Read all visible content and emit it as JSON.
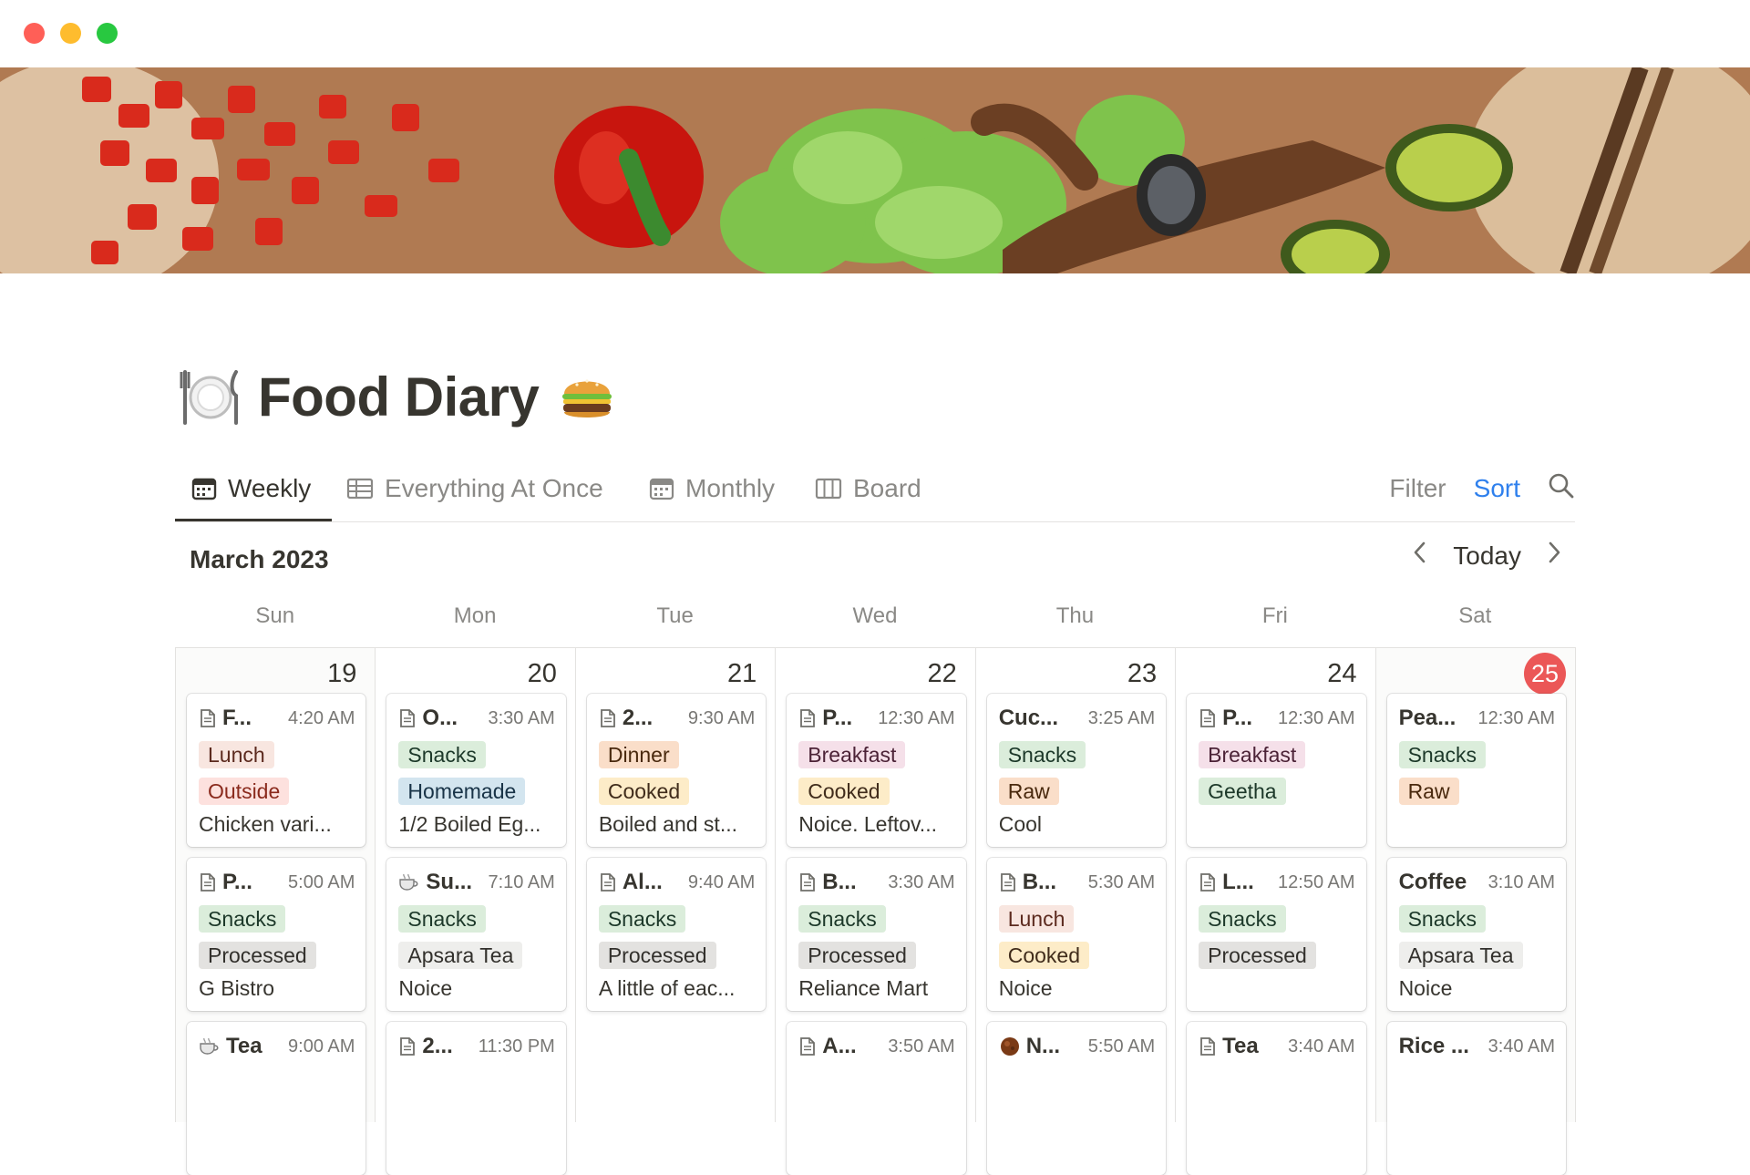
{
  "window": {
    "traffic_lights": [
      "close",
      "minimize",
      "zoom"
    ]
  },
  "page": {
    "title": "Food Diary",
    "icon_left": "plate-icon",
    "icon_right": "burger-icon"
  },
  "tabs": [
    {
      "label": "Weekly",
      "icon": "calendar-icon",
      "active": true
    },
    {
      "label": "Everything At Once",
      "icon": "table-icon",
      "active": false
    },
    {
      "label": "Monthly",
      "icon": "calendar-icon",
      "active": false
    },
    {
      "label": "Board",
      "icon": "board-icon",
      "active": false
    }
  ],
  "toolbar": {
    "filter": "Filter",
    "sort": "Sort",
    "search_icon": "search-icon"
  },
  "calendar": {
    "month": "March 2023",
    "today": "Today",
    "weekdays": [
      "Sun",
      "Mon",
      "Tue",
      "Wed",
      "Thu",
      "Fri",
      "Sat"
    ],
    "days": [
      {
        "num": "19",
        "today": false,
        "entries": [
          {
            "icon": "page",
            "title": "F...",
            "time": "4:20 AM",
            "tags": [
              {
                "label": "Lunch",
                "c": "lunch"
              },
              {
                "label": "Outside",
                "c": "outside"
              }
            ],
            "note": "Chicken vari..."
          },
          {
            "icon": "page",
            "title": "P...",
            "time": "5:00 AM",
            "tags": [
              {
                "label": "Snacks",
                "c": "snacks"
              },
              {
                "label": "Processed",
                "c": "processed"
              }
            ],
            "note": "G Bistro"
          },
          {
            "icon": "tea",
            "title": "Tea",
            "time": "9:00 AM",
            "tags": [],
            "note": ""
          }
        ]
      },
      {
        "num": "20",
        "today": false,
        "entries": [
          {
            "icon": "page",
            "title": "O...",
            "time": "3:30 AM",
            "tags": [
              {
                "label": "Snacks",
                "c": "snacks"
              },
              {
                "label": "Homemade",
                "c": "homemade"
              }
            ],
            "note": "1/2 Boiled Eg..."
          },
          {
            "icon": "tea",
            "title": "Su...",
            "time": "7:10 AM",
            "tags": [
              {
                "label": "Snacks",
                "c": "snacks"
              },
              {
                "label": "Apsara Tea",
                "c": "apsara"
              }
            ],
            "note": "Noice"
          },
          {
            "icon": "page",
            "title": "2...",
            "time": "11:30 PM",
            "tags": [],
            "note": ""
          }
        ]
      },
      {
        "num": "21",
        "today": false,
        "entries": [
          {
            "icon": "page",
            "title": "2...",
            "time": "9:30 AM",
            "tags": [
              {
                "label": "Dinner",
                "c": "dinner"
              },
              {
                "label": "Cooked",
                "c": "cooked"
              }
            ],
            "note": "Boiled and st..."
          },
          {
            "icon": "page",
            "title": "Al...",
            "time": "9:40 AM",
            "tags": [
              {
                "label": "Snacks",
                "c": "snacks"
              },
              {
                "label": "Processed",
                "c": "processed"
              }
            ],
            "note": "A little of eac..."
          }
        ]
      },
      {
        "num": "22",
        "today": false,
        "entries": [
          {
            "icon": "page",
            "title": "P...",
            "time": "12:30 AM",
            "tags": [
              {
                "label": "Breakfast",
                "c": "breakfast"
              },
              {
                "label": "Cooked",
                "c": "cooked"
              }
            ],
            "note": "Noice. Leftov..."
          },
          {
            "icon": "page",
            "title": "B...",
            "time": "3:30 AM",
            "tags": [
              {
                "label": "Snacks",
                "c": "snacks"
              },
              {
                "label": "Processed",
                "c": "processed"
              }
            ],
            "note": "Reliance Mart"
          },
          {
            "icon": "page",
            "title": "A...",
            "time": "3:50 AM",
            "tags": [],
            "note": ""
          }
        ]
      },
      {
        "num": "23",
        "today": false,
        "entries": [
          {
            "icon": "",
            "title": "Cuc...",
            "time": "3:25 AM",
            "tags": [
              {
                "label": "Snacks",
                "c": "snacks"
              },
              {
                "label": "Raw",
                "c": "raw"
              }
            ],
            "note": "Cool"
          },
          {
            "icon": "page",
            "title": "B...",
            "time": "5:30 AM",
            "tags": [
              {
                "label": "Lunch",
                "c": "lunch"
              },
              {
                "label": "Cooked",
                "c": "cooked"
              }
            ],
            "note": "Noice"
          },
          {
            "icon": "coconut",
            "title": "N...",
            "time": "5:50 AM",
            "tags": [],
            "note": ""
          }
        ]
      },
      {
        "num": "24",
        "today": false,
        "entries": [
          {
            "icon": "page",
            "title": "P...",
            "time": "12:30 AM",
            "tags": [
              {
                "label": "Breakfast",
                "c": "breakfast"
              },
              {
                "label": "Geetha",
                "c": "geetha"
              }
            ],
            "note": ""
          },
          {
            "icon": "page",
            "title": "L...",
            "time": "12:50 AM",
            "tags": [
              {
                "label": "Snacks",
                "c": "snacks"
              },
              {
                "label": "Processed",
                "c": "processed"
              }
            ],
            "note": ""
          },
          {
            "icon": "page",
            "title": "Tea",
            "time": "3:40 AM",
            "tags": [],
            "note": ""
          }
        ]
      },
      {
        "num": "25",
        "today": true,
        "entries": [
          {
            "icon": "",
            "title": "Pea...",
            "time": "12:30 AM",
            "tags": [
              {
                "label": "Snacks",
                "c": "snacks"
              },
              {
                "label": "Raw",
                "c": "raw"
              }
            ],
            "note": ""
          },
          {
            "icon": "",
            "title": "Coffee",
            "time": "3:10 AM",
            "tags": [
              {
                "label": "Snacks",
                "c": "snacks"
              },
              {
                "label": "Apsara Tea",
                "c": "apsara"
              }
            ],
            "note": "Noice"
          },
          {
            "icon": "",
            "title": "Rice ...",
            "time": "3:40 AM",
            "tags": [],
            "note": ""
          }
        ]
      }
    ]
  }
}
